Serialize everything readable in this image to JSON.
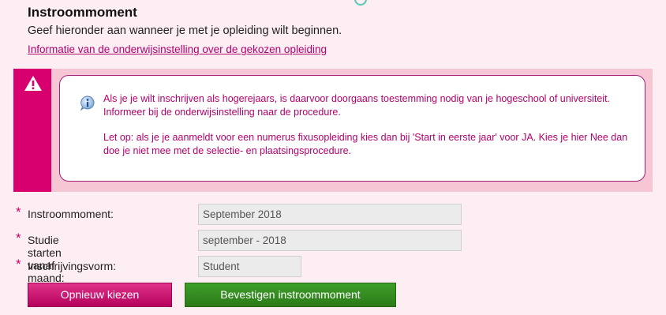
{
  "section": {
    "title": "Instroommoment",
    "subtitle": "Geef hieronder aan wanneer je met je opleiding wilt beginnen.",
    "info_link": "Informatie van de onderwijsinstelling over de gekozen opleiding"
  },
  "warning": {
    "paragraph1": "Als je je wilt inschrijven als hogerejaars, is daarvoor doorgaans toestemming nodig van je hogeschool of universiteit. Informeer bij de onderwijsinstelling naar de procedure.",
    "paragraph2": "Let op: als je je aanmeldt voor een numerus fixusopleiding kies dan bij 'Start in eerste jaar' voor JA. Kies je hier Nee dan doe je niet mee met de selectie- en plaatsingsprocedure."
  },
  "fields": [
    {
      "label": "Instroommoment:",
      "value": "September 2018",
      "required": "*"
    },
    {
      "label": "Studie starten vanaf maand:",
      "value": "september - 2018",
      "required": "*"
    },
    {
      "label": "Inschrijvingsvorm:",
      "value": "Student",
      "required": "*"
    }
  ],
  "buttons": {
    "restart": "Opnieuw kiezen",
    "confirm": "Bevestigen instroommoment"
  },
  "icons": {
    "warning": "warning-triangle-icon",
    "info": "info-icon"
  },
  "colors": {
    "accent": "#d8006f",
    "link": "#b3006b",
    "confirm": "#2f8a1e",
    "background": "#fdeef4"
  }
}
